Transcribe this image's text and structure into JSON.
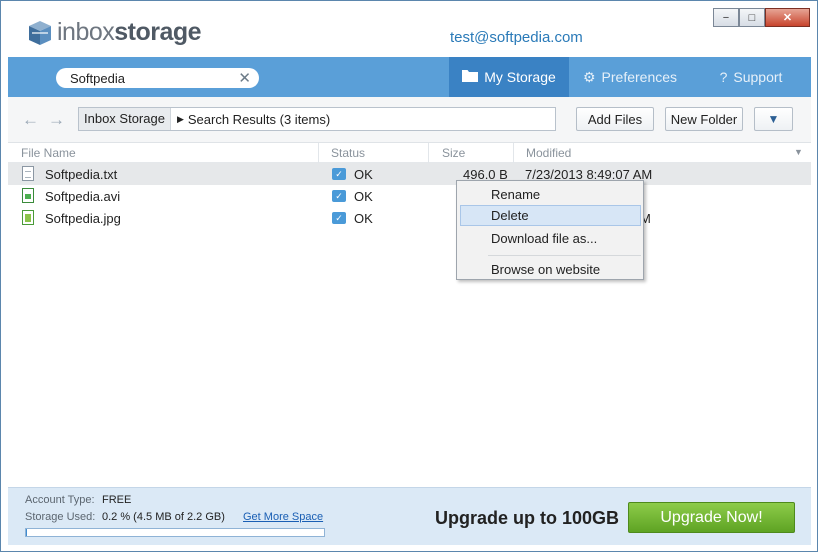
{
  "header": {
    "logo_light": "inbox",
    "logo_dark": "storage",
    "email": "test@softpedia.com"
  },
  "window_controls": {
    "minimize": "−",
    "maximize": "□",
    "close": "✕"
  },
  "search": {
    "value": "Softpedia",
    "clear": "✕"
  },
  "nav": {
    "tabs": [
      {
        "label": "My Storage",
        "icon": "folder-icon"
      },
      {
        "label": "Preferences",
        "icon": "gear-icon"
      },
      {
        "label": "Support",
        "icon": "question-icon"
      }
    ]
  },
  "toolbar": {
    "back": "←",
    "forward": "→",
    "breadcrumb_root": "Inbox Storage",
    "breadcrumb_current": "Search Results (3 items)",
    "add_files": "Add Files",
    "new_folder": "New Folder",
    "more": "▼"
  },
  "columns": [
    "File Name",
    "Status",
    "Size",
    "Modified"
  ],
  "files": [
    {
      "name": "Softpedia.txt",
      "status": "OK",
      "size": "496.0 B",
      "modified": "7/23/2013 8:49:07 AM",
      "type": "txt"
    },
    {
      "name": "Softpedia.avi",
      "status": "OK",
      "size": "",
      "modified": "",
      "type": "vid"
    },
    {
      "name": "Softpedia.jpg",
      "status": "OK",
      "size": "",
      "modified": "M",
      "type": "img"
    }
  ],
  "context_menu": {
    "items": [
      "Rename",
      "Delete",
      "Download file as...",
      "Browse on website"
    ],
    "highlighted": "Delete"
  },
  "footer": {
    "account_type_label": "Account Type:",
    "account_type": "FREE",
    "storage_used_label": "Storage Used:",
    "storage_used": "0.2 % (4.5 MB of 2.2 GB)",
    "storage_fraction": 0.002,
    "get_more_space": "Get More Space",
    "upgrade_text": "Upgrade up to 100GB",
    "upgrade_button": "Upgrade Now!"
  }
}
